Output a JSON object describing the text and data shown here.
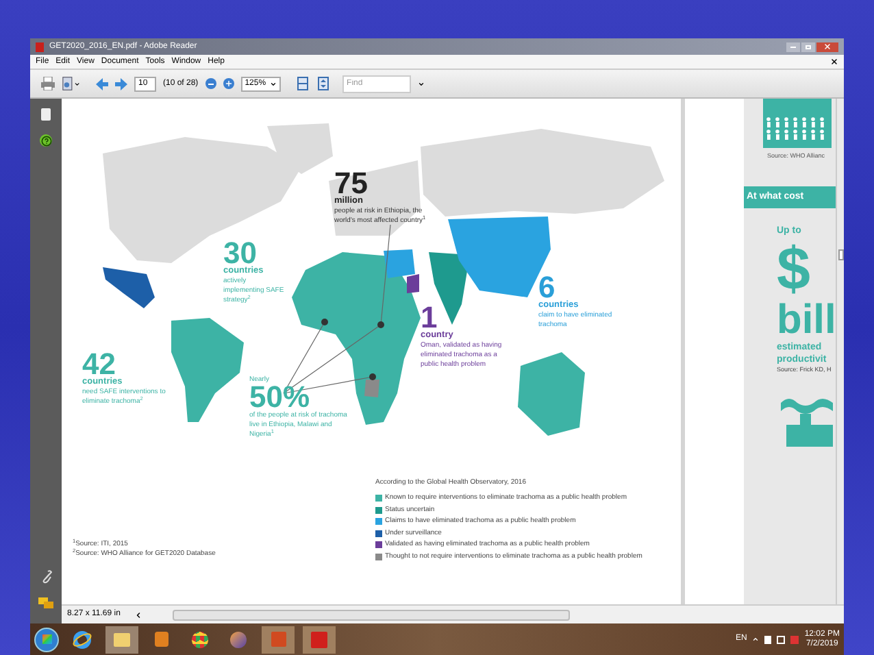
{
  "window": {
    "title": "GET2020_2016_EN.pdf - Adobe Reader"
  },
  "menu": [
    "File",
    "Edit",
    "View",
    "Document",
    "Tools",
    "Window",
    "Help"
  ],
  "toolbar": {
    "page_number": "10",
    "page_count": "(10 of 28)",
    "zoom": "125%",
    "find": {
      "placeholder": "Find"
    }
  },
  "map": {
    "callouts": [
      {
        "number": "75",
        "unit": "million",
        "text": "people at risk in Ethiopia, the world's most affected country$^{1}$",
        "color": "#222222"
      },
      {
        "number": "30",
        "unit": "countries",
        "text": "actively implementing SAFE strategy$^{2}$",
        "color": "#3db3a5"
      },
      {
        "number": "42",
        "unit": "countries",
        "text": "need SAFE interventions to eliminate trachoma$^{2}$",
        "color": "#3db3a5"
      },
      {
        "prefix": "Nearly",
        "number": "50%",
        "text": "of the people at risk of trachoma live in Ethiopia, Malawi and Nigeria$^{1}$",
        "color": "#3db3a5"
      },
      {
        "number": "1",
        "unit": "country",
        "text": "Oman, validated as having eliminated trachoma as a public health problem",
        "color": "#6b3d9a"
      },
      {
        "number": "6",
        "unit": "countries",
        "text": "claim to have eliminated trachoma",
        "color": "#2a9fd8"
      }
    ]
  },
  "legend": {
    "title": "According to the Global Health Observatory, 2016",
    "items": [
      {
        "label": "Known to require interventions to eliminate trachoma as a public health problem",
        "color": "#3db3a5"
      },
      {
        "label": "Status uncertain",
        "color": "#1e9a8e"
      },
      {
        "label": "Claims to have eliminated trachoma as a public health problem",
        "color": "#2aa3e0"
      },
      {
        "label": "Under surveillance",
        "color": "#1d5fa8"
      },
      {
        "label": "Validated as having eliminated trachoma as a public health problem",
        "color": "#6b3d9a"
      },
      {
        "label": "Thought to not require interventions to eliminate trachoma as a public health problem",
        "color": "#8a8a8a"
      }
    ]
  },
  "sources": [
    "$^{1}$Source: ITI, 2015",
    "$^{2}$Source: WHO Alliance for GET2020 Database"
  ],
  "right_page": {
    "source_top": "Source: WHO Allianc",
    "banner": "At what cost",
    "lead": "Up to",
    "amount": "$",
    "unit": "bill",
    "caption": [
      "estimated",
      "productivit"
    ],
    "source": "Source: Frick KD, H"
  },
  "status_bar": {
    "page_size": "8.27 x 11.69 in"
  },
  "taskbar": {
    "language": "EN",
    "time": "12:02 PM",
    "date": "7/2/2019"
  }
}
